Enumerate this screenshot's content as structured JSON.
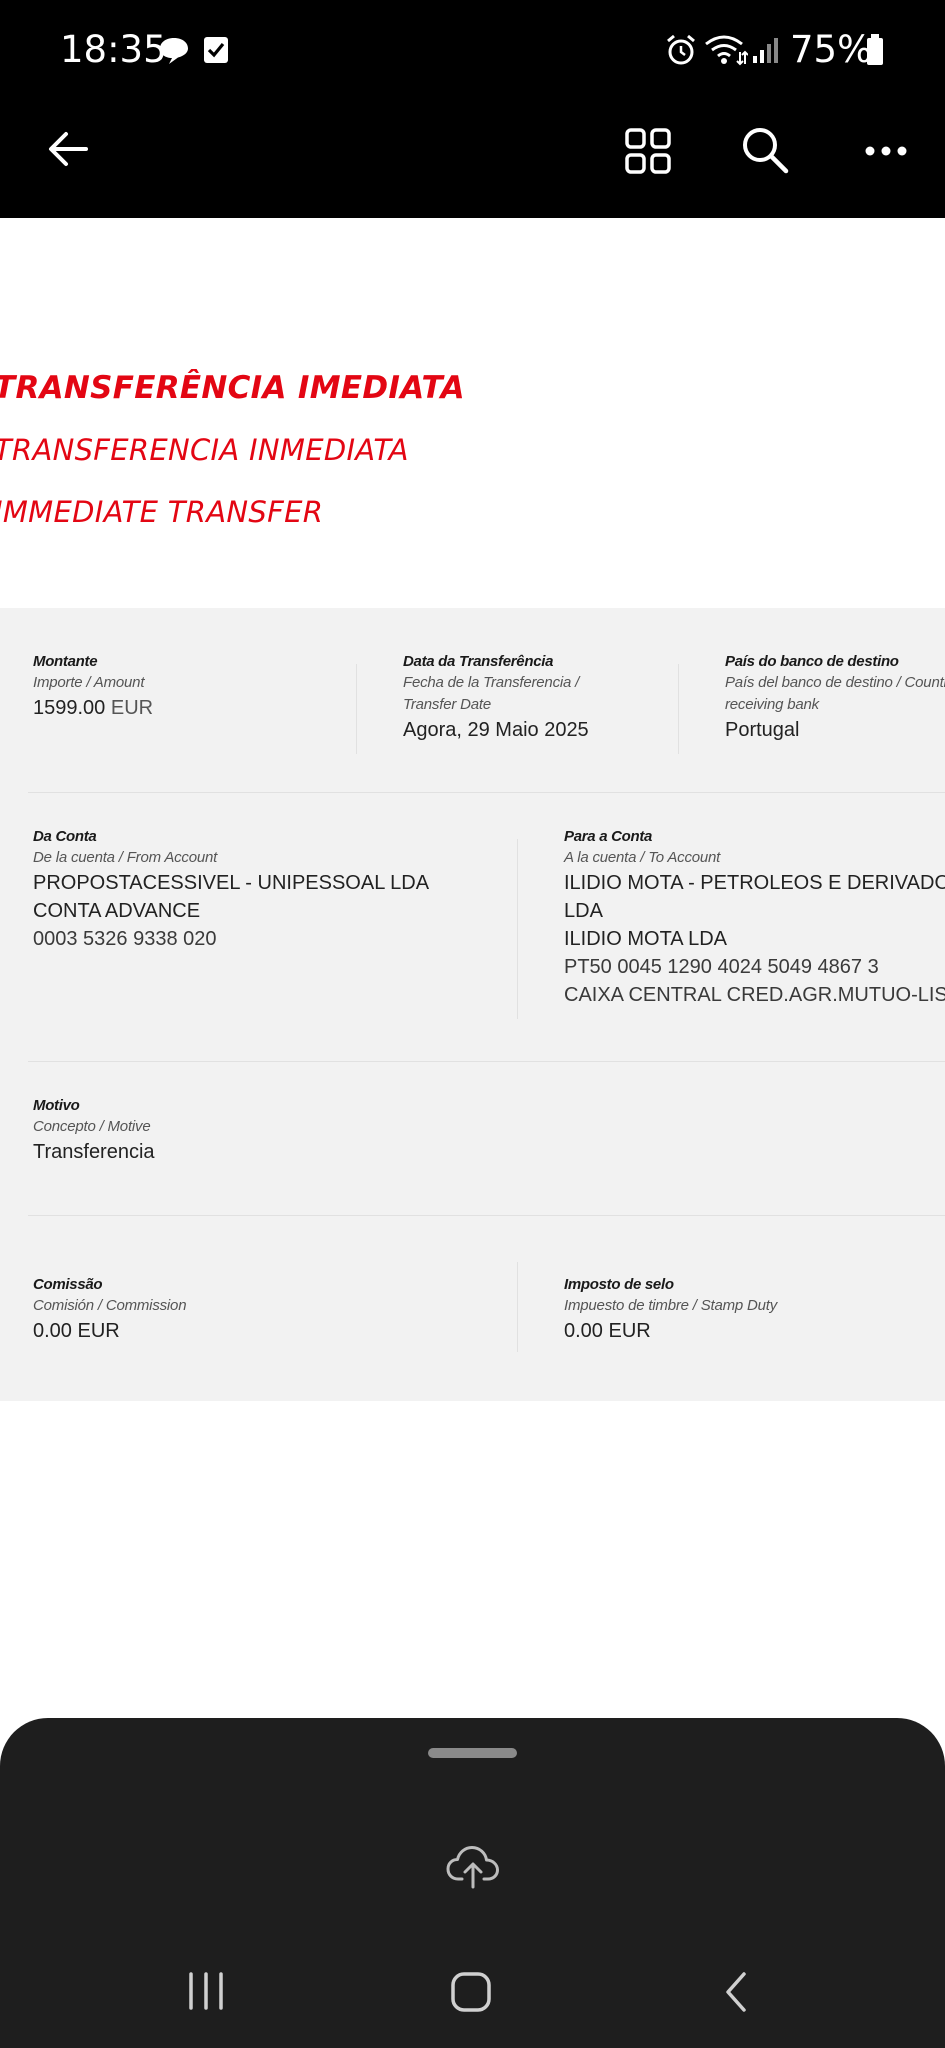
{
  "status_bar": {
    "time": "18:35",
    "battery": "75%"
  },
  "header": {
    "title_pt": "TRANSFERÊNCIA IMEDIATA",
    "title_es": "TRANSFERENCIA INMEDIATA",
    "title_en": "IMMEDIATE TRANSFER"
  },
  "details": {
    "amount": {
      "label": "Montante",
      "sub": "Importe / Amount",
      "value": "1599.00",
      "currency": "EUR"
    },
    "date": {
      "label": "Data da Transferência",
      "sub1": "Fecha de la Transferencia /",
      "sub2": "Transfer Date",
      "value": "Agora, 29 Maio 2025"
    },
    "country": {
      "label": "País do banco de destino",
      "sub1": "País del banco de destino / Country of",
      "sub2": "receiving bank",
      "value": "Portugal"
    },
    "from": {
      "label": "Da Conta",
      "sub": "De la cuenta / From Account",
      "line1": "PROPOSTACESSIVEL - UNIPESSOAL LDA",
      "line2": "CONTA ADVANCE",
      "line3": "0003 5326 9338 020"
    },
    "to": {
      "label": "Para a Conta",
      "sub": "A la cuenta / To Account",
      "line1": "ILIDIO MOTA - PETROLEOS E DERIVADOS",
      "line2": "LDA",
      "line3": "ILIDIO MOTA LDA",
      "line4": "PT50 0045 1290 4024 5049 4867 3",
      "line5": "CAIXA CENTRAL CRED.AGR.MUTUO-LISBOA"
    },
    "motive": {
      "label": "Motivo",
      "sub": "Concepto / Motive",
      "value": "Transferencia"
    },
    "commission": {
      "label": "Comissão",
      "sub": "Comisión / Commission",
      "value": "0.00 EUR"
    },
    "stamp_duty": {
      "label": "Imposto de selo",
      "sub": "Impuesto de timbre / Stamp Duty",
      "value": "0.00 EUR"
    }
  },
  "icons": {
    "status": [
      "chat-bubble-icon",
      "checkbox-icon",
      "alarm-icon",
      "wifi-icon",
      "signal-icon",
      "battery-icon"
    ],
    "app_bar": [
      "back-arrow-icon",
      "grid-icon",
      "search-icon",
      "more-icon"
    ],
    "sheet": [
      "cloud-upload-icon"
    ],
    "nav": [
      "recents-icon",
      "home-icon",
      "back-icon"
    ]
  },
  "colors": {
    "accent": "#e30613",
    "panel": "#f2f2f2",
    "bars": "#000000",
    "sheet": "#1e1e1e"
  }
}
